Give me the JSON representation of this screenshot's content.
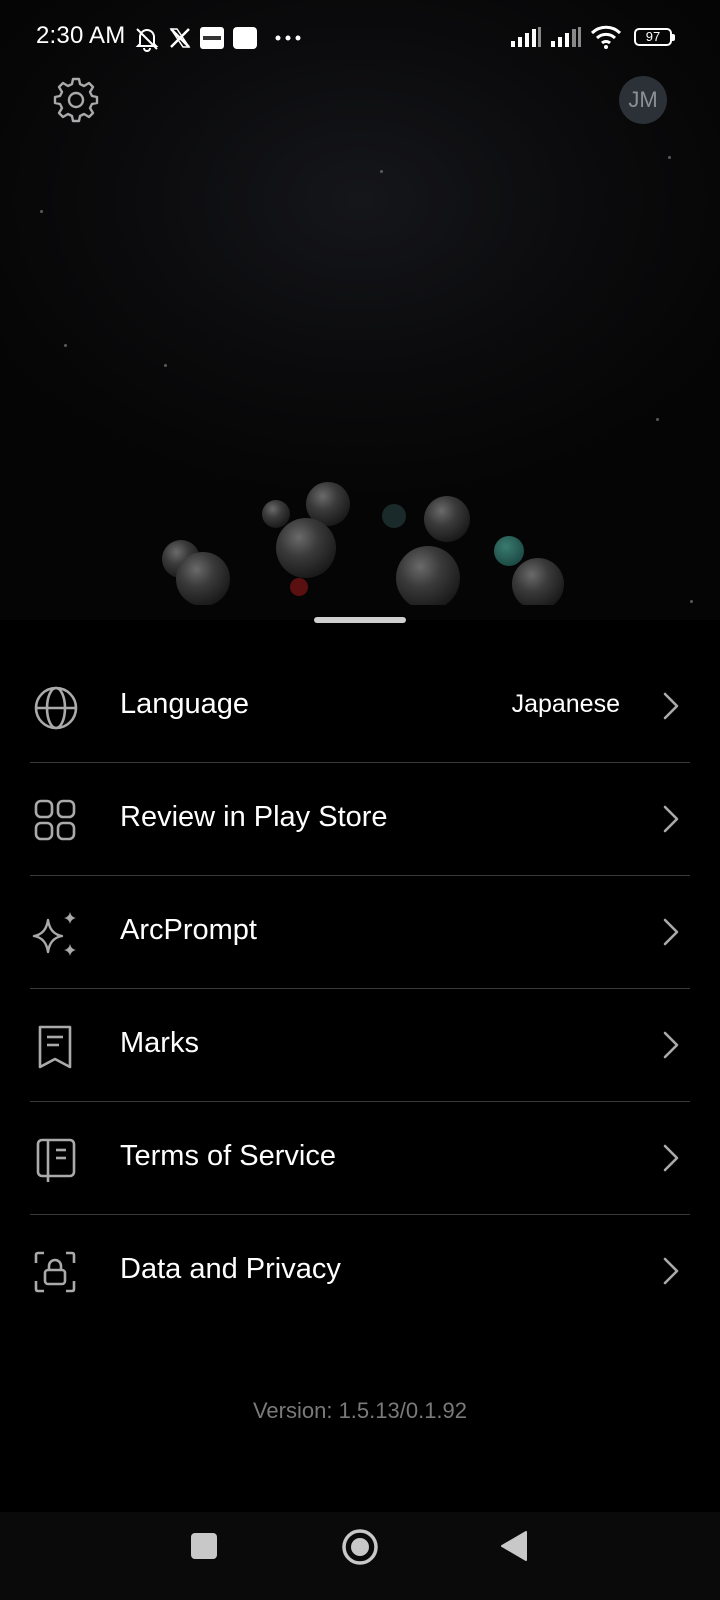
{
  "status_bar": {
    "time": "2:30 AM",
    "battery": "97",
    "icons": [
      "notifications-off-icon",
      "x-logo-icon",
      "bybit-icon",
      "app-square-icon",
      "more-dots-icon",
      "signal-icon",
      "signal-icon",
      "wifi-icon",
      "battery-icon"
    ]
  },
  "header": {
    "settings_icon": "gear-icon",
    "avatar_initials": "JM"
  },
  "menu": {
    "items": [
      {
        "label": "Language",
        "value": "Japanese",
        "icon": "globe-icon"
      },
      {
        "label": "Review in Play Store",
        "icon": "grid-icon"
      },
      {
        "label": "ArcPrompt",
        "icon": "sparkles-icon"
      },
      {
        "label": "Marks",
        "icon": "bookmark-icon"
      },
      {
        "label": "Terms of Service",
        "icon": "book-icon"
      },
      {
        "label": "Data and Privacy",
        "icon": "lock-icon"
      }
    ]
  },
  "footer": {
    "version": "Version: 1.5.13/0.1.92"
  },
  "nav_bar": {
    "icons": [
      "recents-square-icon",
      "home-circle-icon",
      "back-triangle-icon"
    ]
  },
  "colors": {
    "background": "#000000",
    "divider": "#3a3a3a",
    "muted_text": "#7a7a7a",
    "avatar_bg": "#2b3136"
  }
}
